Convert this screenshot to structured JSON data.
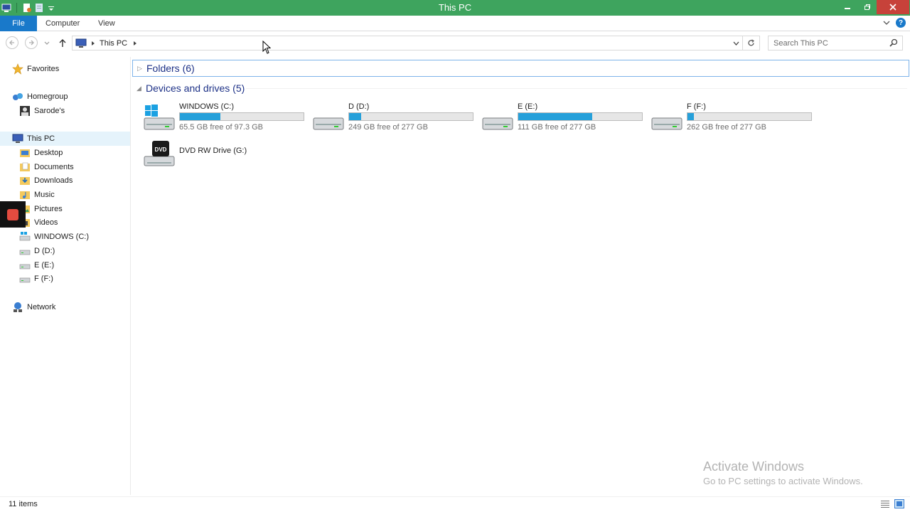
{
  "window": {
    "title": "This PC",
    "minimize": "🗕",
    "maximize": "🗗",
    "close": "✕"
  },
  "ribbon": {
    "tabs": [
      "File",
      "Computer",
      "View"
    ],
    "help": "?"
  },
  "address": {
    "path": "This PC",
    "search_placeholder": "Search This PC"
  },
  "nav": {
    "favorites": "Favorites",
    "homegroup": "Homegroup",
    "user": "Sarode's",
    "this_pc": "This PC",
    "desktop": "Desktop",
    "documents": "Documents",
    "downloads": "Downloads",
    "music": "Music",
    "pictures": "Pictures",
    "videos": "Videos",
    "drive_c": "WINDOWS (C:)",
    "drive_d": "D (D:)",
    "drive_e": "E (E:)",
    "drive_f": "F (F:)",
    "network": "Network"
  },
  "groups": {
    "folders": "Folders (6)",
    "devices": "Devices and drives (5)"
  },
  "drives": [
    {
      "name": "WINDOWS (C:)",
      "free": "65.5 GB free of 97.3 GB",
      "used_fraction": 0.33
    },
    {
      "name": "D (D:)",
      "free": "249 GB free of 277 GB",
      "used_fraction": 0.1
    },
    {
      "name": "E (E:)",
      "free": "111 GB free of 277 GB",
      "used_fraction": 0.6
    },
    {
      "name": "F (F:)",
      "free": "262 GB free of 277 GB",
      "used_fraction": 0.05
    }
  ],
  "dvd": {
    "name": "DVD RW Drive (G:)",
    "label": "DVD"
  },
  "status": {
    "count": "11 items"
  },
  "watermark": {
    "line1": "Activate Windows",
    "line2": "Go to PC settings to activate Windows."
  },
  "colors": {
    "titlebar": "#3ea45e",
    "file_tab": "#1979ca",
    "bar_fill": "#26a0da",
    "close": "#c7423a"
  }
}
